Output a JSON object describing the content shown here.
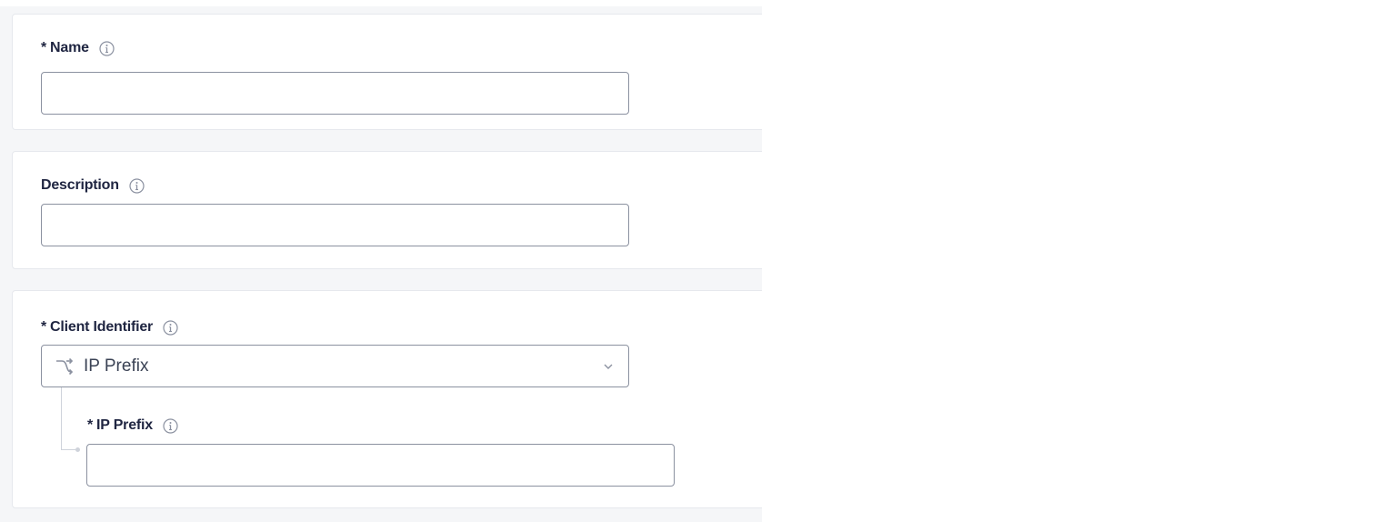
{
  "form": {
    "name": {
      "required_mark": "*",
      "label": "Name",
      "value": "",
      "placeholder": ""
    },
    "description": {
      "label": "Description",
      "value": "",
      "placeholder": ""
    },
    "client_identifier": {
      "required_mark": "*",
      "label": "Client Identifier",
      "selected": "IP Prefix",
      "icon": "route-icon"
    },
    "ip_prefix": {
      "required_mark": "*",
      "label": "IP Prefix",
      "value": "",
      "placeholder": ""
    }
  },
  "colors": {
    "label_text": "#1f2541",
    "border": "#8b91a0",
    "card_border": "#e6e8ed",
    "page_bg": "#f5f6f8"
  }
}
